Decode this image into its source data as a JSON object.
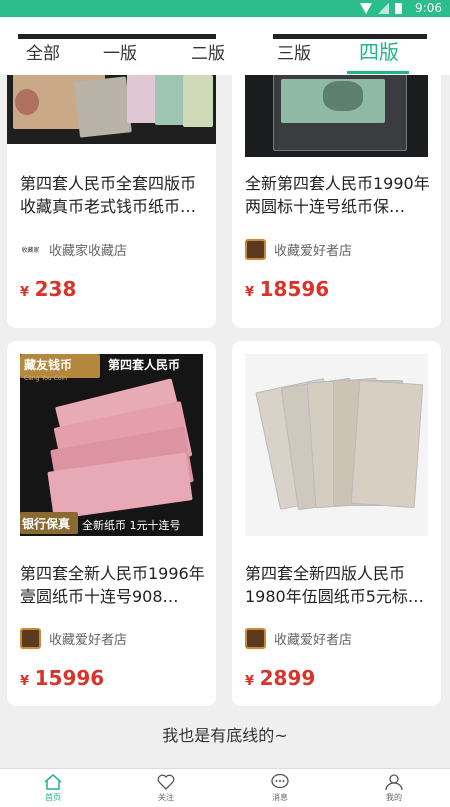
{
  "status_bar": {
    "time": "9:06"
  },
  "tabs": [
    {
      "label": "全部"
    },
    {
      "label": "一版"
    },
    {
      "label": "二版"
    },
    {
      "label": "三版"
    },
    {
      "label": "四版",
      "active": true
    }
  ],
  "products": [
    {
      "title": "第四套人民币全套四版币收藏真币老式钱币纸币…",
      "shop": "收藏家收藏店",
      "shop_logo_text": "收藏家",
      "currency": "¥",
      "price": "238"
    },
    {
      "title": "全新第四套人民币1990年两圆标十连号纸币保…",
      "shop": "收藏爱好者店",
      "currency": "¥",
      "price": "18596"
    },
    {
      "title": "第四套全新人民币1996年壹圆纸币十连号908…",
      "shop": "收藏爱好者店",
      "currency": "¥",
      "price": "15996",
      "image_texts": {
        "top_left": "藏友钱币",
        "top_left_sub": "Cang You Coin",
        "top_right": "第四套人民币",
        "bottom_left": "银行保真",
        "bottom_right": "全新纸币  1元十连号"
      }
    },
    {
      "title": "第四套全新四版人民币1980年伍圆纸币5元标…",
      "shop": "收藏爱好者店",
      "currency": "¥",
      "price": "2899"
    }
  ],
  "footer_text": "我也是有底线的~",
  "bottom_nav": [
    {
      "label": "首页",
      "icon": "home-icon",
      "active": true
    },
    {
      "label": "关注",
      "icon": "heart-icon"
    },
    {
      "label": "消息",
      "icon": "message-icon"
    },
    {
      "label": "我的",
      "icon": "user-icon"
    }
  ],
  "colors": {
    "accent": "#23b488",
    "status_bar": "#2bbd8b",
    "price": "#d9342b"
  }
}
